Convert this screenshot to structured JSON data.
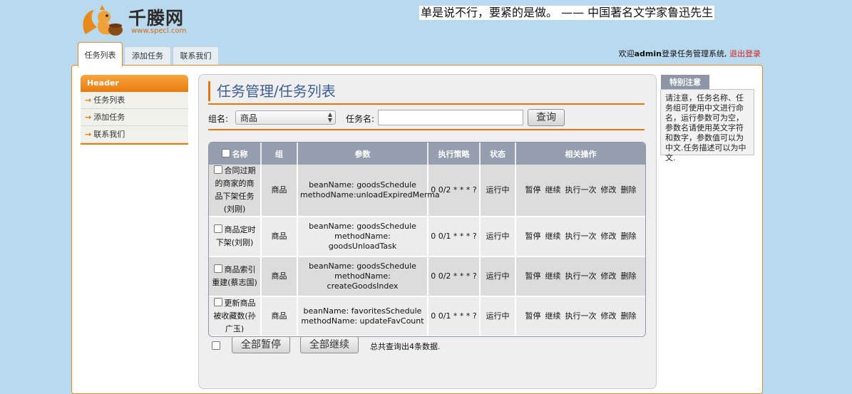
{
  "logo": {
    "brand": "千媵网",
    "site": "www.specl.com"
  },
  "quote": "单是说不行，要紧的是做。 —— 中国著名文学家鲁迅先生",
  "top_tabs": [
    {
      "label": "任务列表",
      "active": true
    },
    {
      "label": "添加任务",
      "active": false
    },
    {
      "label": "联系我们",
      "active": false
    }
  ],
  "welcome": {
    "prefix": "欢迎",
    "user": "admin",
    "suffix": "登录任务管理系统,",
    "logout": "退出登录"
  },
  "sidebar": {
    "header": "Header",
    "items": [
      {
        "label": "任务列表"
      },
      {
        "label": "添加任务"
      },
      {
        "label": "联系我们"
      }
    ]
  },
  "page_title": "任务管理/任务列表",
  "search": {
    "group_label": "组名:",
    "group_value": "商品",
    "task_label": "任务名:",
    "task_value": "",
    "query_button": "查询"
  },
  "table": {
    "headers": [
      "名称",
      "组",
      "参数",
      "执行策略",
      "状态",
      "相关操作"
    ],
    "rows": [
      {
        "name": "合同过期的商家的商品下架任务 (刘刚)",
        "group": "商品",
        "bean": "beanName: goodsSchedule",
        "method": "methodName:unloadExpiredMerma",
        "cron": "0 0/2 * * * ?",
        "status": "运行中"
      },
      {
        "name": "商品定时下架(刘刚)",
        "group": "商品",
        "bean": "beanName: goodsSchedule",
        "method": "methodName: goodsUnloadTask",
        "cron": "0 0/1 * * * ?",
        "status": "运行中"
      },
      {
        "name": "商品索引重建(蔡志国)",
        "group": "商品",
        "bean": "beanName: goodsSchedule",
        "method": "methodName: createGoodsIndex",
        "cron": "0 0/2 * * * ?",
        "status": "运行中"
      },
      {
        "name": "更新商品被收藏数(孙广玉)",
        "group": "商品",
        "bean": "beanName: favoritesSchedule",
        "method": "methodName: updateFavCount",
        "cron": "0 0/1 * * * ?",
        "status": "运行中"
      }
    ],
    "actions": [
      "暂停",
      "继续",
      "执行一次",
      "修改",
      "删除"
    ]
  },
  "footer": {
    "pause_all": "全部暂停",
    "resume_all": "全部继续",
    "total": "总共查询出4条数据."
  },
  "notice": {
    "title": "特别注意",
    "text": "请注意，任务名称、任务组可使用中文进行命名，运行参数可为空，参数名请使用英文字符和数字，参数值可以为中文.任务描述可以为中文."
  },
  "colors": {
    "accent": "#e8740e",
    "title_blue": "#3e5e93",
    "logout_red": "#d61f1f",
    "table_header": "#959eaf"
  }
}
